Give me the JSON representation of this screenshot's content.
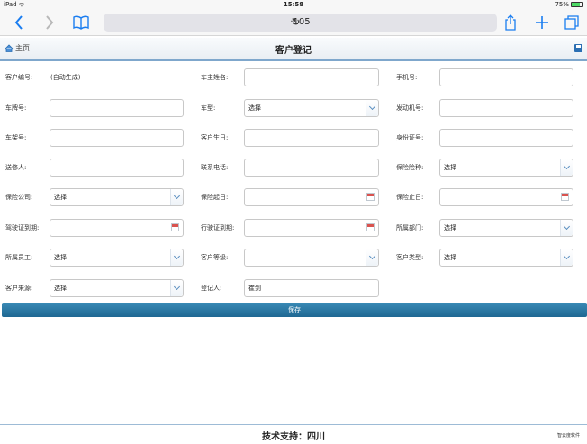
{
  "status_bar": {
    "device": "iPad ᯤ",
    "time": "15:58",
    "battery": "75%"
  },
  "browser": {
    "url": "·105",
    "back_icon": "chevron-left-icon",
    "forward_icon": "chevron-right-icon",
    "bookmarks_icon": "book-icon",
    "reload_icon": "reload-icon",
    "share_icon": "share-icon",
    "add_icon": "plus-icon",
    "tabs_icon": "tabs-icon"
  },
  "header": {
    "home_label": "主页",
    "title": "客户登记"
  },
  "form": {
    "customer_no": {
      "label": "客户编号:",
      "value": "(自动生成)"
    },
    "owner_name": {
      "label": "车主姓名:",
      "value": ""
    },
    "phone": {
      "label": "手机号:",
      "value": ""
    },
    "plate_no": {
      "label": "车牌号:",
      "value": ""
    },
    "car_model": {
      "label": "车型:",
      "value": "选择"
    },
    "engine_no": {
      "label": "发动机号:",
      "value": ""
    },
    "frame_no": {
      "label": "车架号:",
      "value": ""
    },
    "birthday": {
      "label": "客户生日:",
      "value": ""
    },
    "id_card": {
      "label": "身份证号:",
      "value": ""
    },
    "sender": {
      "label": "送修人:",
      "value": ""
    },
    "contact_phone": {
      "label": "联系电话:",
      "value": ""
    },
    "insurance_type": {
      "label": "保险险种:",
      "value": "选择"
    },
    "insurance_company": {
      "label": "保险公司:",
      "value": "选择"
    },
    "insurance_start": {
      "label": "保险起日:",
      "value": ""
    },
    "insurance_end": {
      "label": "保险止日:",
      "value": ""
    },
    "license_expiry": {
      "label": "驾驶证到期:",
      "value": ""
    },
    "vehicle_license_expiry": {
      "label": "行驶证到期:",
      "value": ""
    },
    "department": {
      "label": "所属部门:",
      "value": "选择"
    },
    "employee": {
      "label": "所属员工:",
      "value": "选择"
    },
    "customer_level": {
      "label": "客户等级:",
      "value": ""
    },
    "customer_type": {
      "label": "客户类型:",
      "value": "选择"
    },
    "customer_source": {
      "label": "客户来源:",
      "value": "选择"
    },
    "registrar": {
      "label": "登记人:",
      "value": "崔剑"
    }
  },
  "save_label": "保存",
  "footer": {
    "support": "技术支持：四川",
    "brand": "智云度软件"
  },
  "colors": {
    "accent": "#1a7df0",
    "save_button": "#2a77a3"
  }
}
